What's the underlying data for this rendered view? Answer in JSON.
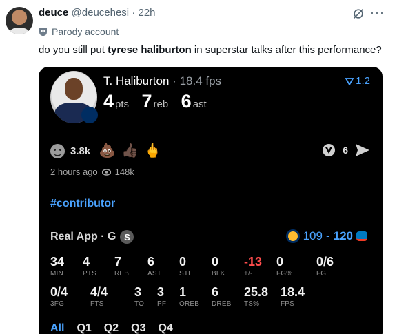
{
  "tweet": {
    "display_name": "deuce",
    "handle": "@deucehesi",
    "separator": "·",
    "time": "22h",
    "account_label": "Parody account",
    "text_part1": "do you still put ",
    "text_bold": "tyrese haliburton",
    "text_part2": " in superstar talks after this performance?"
  },
  "card": {
    "player_name": "T. Haliburton",
    "separator": "·",
    "fps_value": "18.4 fps",
    "pts": "4",
    "pts_label": "pts",
    "reb": "7",
    "reb_label": "reb",
    "ast": "6",
    "ast_label": "ast",
    "fps_badge": "1.2",
    "reactions_count": "3.8k",
    "reaction_emojis": [
      "💩",
      "👍🏿",
      "🖕"
    ],
    "comments_count": "6",
    "posted_ago": "2 hours ago",
    "views": "148k",
    "hashtag": "#contributor",
    "source": "Real App · G",
    "source_badge": "S",
    "score_home": "109",
    "score_sep": "-",
    "score_away": "120",
    "stats_row1": [
      {
        "value": "34",
        "label": "MIN"
      },
      {
        "value": "4",
        "label": "PTS"
      },
      {
        "value": "7",
        "label": "REB"
      },
      {
        "value": "6",
        "label": "AST"
      },
      {
        "value": "0",
        "label": "STL"
      },
      {
        "value": "0",
        "label": "BLK"
      },
      {
        "value": "-13",
        "label": "+/-"
      },
      {
        "value": "0",
        "label": "FG%"
      },
      {
        "value": "0/6",
        "label": "FG"
      }
    ],
    "stats_row2": [
      {
        "value": "0/4",
        "label": "3FG"
      },
      {
        "value": "4/4",
        "label": "FTS"
      },
      {
        "value": "3",
        "label": "TO"
      },
      {
        "value": "3",
        "label": "PF"
      },
      {
        "value": "1",
        "label": "OREB"
      },
      {
        "value": "6",
        "label": "DREB"
      },
      {
        "value": "25.8",
        "label": "TS%"
      },
      {
        "value": "18.4",
        "label": "FPS"
      }
    ],
    "quarter_tabs": [
      "All",
      "Q1",
      "Q2",
      "Q3",
      "Q4"
    ]
  },
  "colors": {
    "accent_blue": "#4aa3ff",
    "negative_red": "#ff4d4d",
    "card_bg": "#000000"
  },
  "icons": [
    "avatar",
    "grok-icon",
    "more-icon",
    "parody-label-icon",
    "fps-arrow-icon",
    "smile-icon",
    "v-icon",
    "send-icon",
    "eye-icon",
    "pacers-logo",
    "thunder-logo"
  ]
}
